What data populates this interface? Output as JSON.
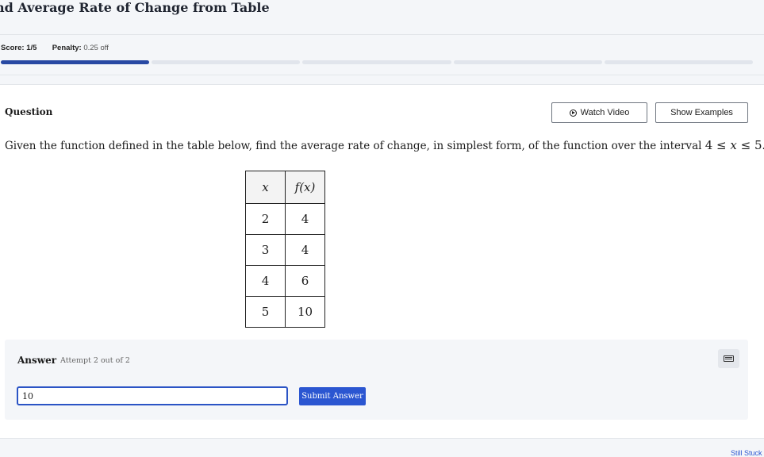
{
  "header": {
    "title": "nd Average Rate of Change from Table"
  },
  "score": {
    "score_label": "Score:",
    "score_value": "1/5",
    "penalty_label": "Penalty:",
    "penalty_value": "0.25 off",
    "progress_filled_segments": 1,
    "progress_total_segments": 5
  },
  "question": {
    "label": "Question",
    "watch_video_label": "Watch Video",
    "show_examples_label": "Show Examples",
    "text": "Given the function defined in the table below, find the average rate of change, in simplest form, of the function over the interval ",
    "interval": "4 ≤ 𝑥 ≤ 5",
    "text_end": ".",
    "table": {
      "headers": [
        "𝑥",
        "𝑓(𝑥)"
      ],
      "rows": [
        [
          "2",
          "4"
        ],
        [
          "3",
          "4"
        ],
        [
          "4",
          "6"
        ],
        [
          "5",
          "10"
        ]
      ]
    }
  },
  "answer": {
    "label": "Answer",
    "attempt": "Attempt 2 out of 2",
    "input_value": "10",
    "submit_label": "Submit Answer"
  },
  "footer": {
    "still_stuck": "Still Stuck"
  },
  "colors": {
    "accent": "#2b56d1",
    "progress_filled": "#2849a3",
    "progress_empty": "#e1e5ec"
  }
}
